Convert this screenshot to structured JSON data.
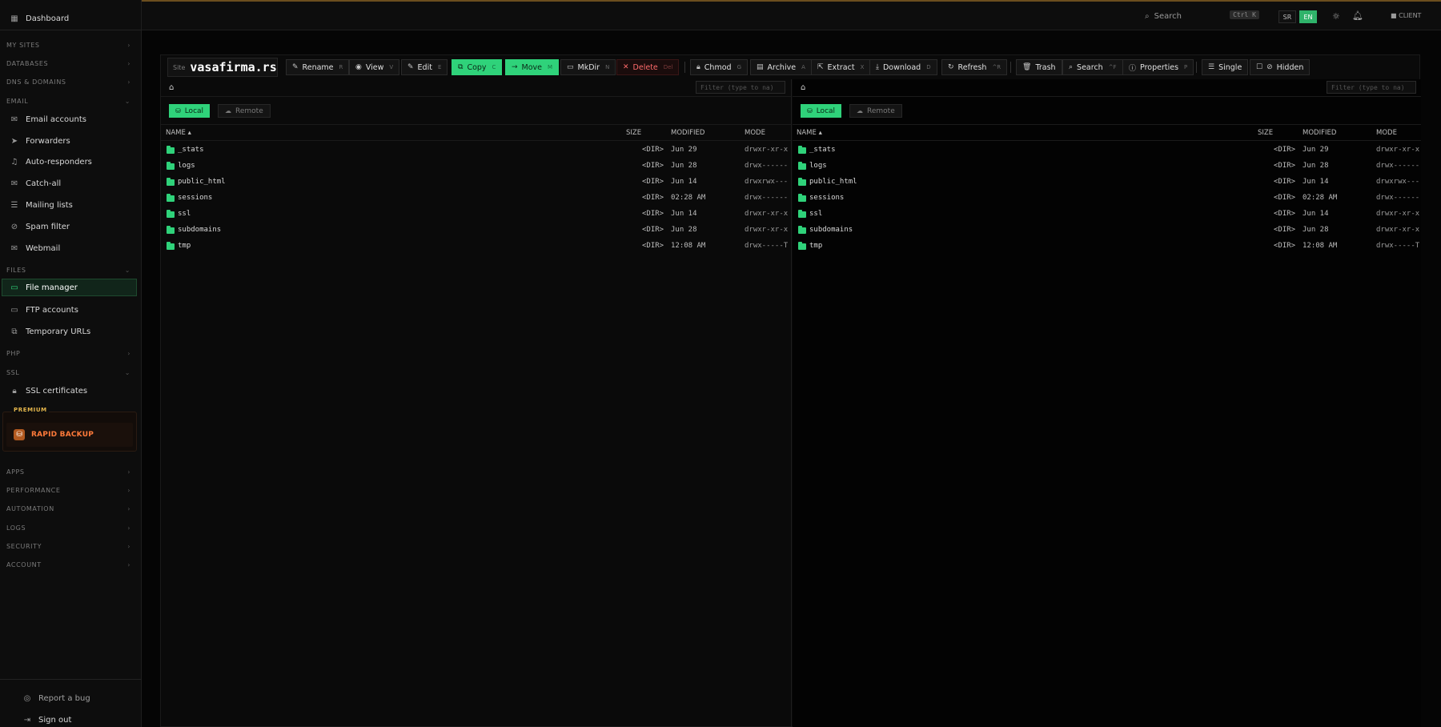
{
  "sidebar": {
    "dashboard": "Dashboard",
    "sections": {
      "my_sites": "MY SITES",
      "databases": "DATABASES",
      "dns": "DNS & DOMAINS",
      "email": "EMAIL",
      "files": "FILES",
      "php": "PHP",
      "ssl": "SSL",
      "apps": "APPS",
      "performance": "PERFORMANCE",
      "automation": "AUTOMATION",
      "logs": "LOGS",
      "security": "SECURITY",
      "account": "ACCOUNT"
    },
    "email_items": [
      "Email accounts",
      "Forwarders",
      "Auto-responders",
      "Catch-all",
      "Mailing lists",
      "Spam filter",
      "Webmail"
    ],
    "files_items": [
      "File manager",
      "FTP accounts",
      "Temporary URLs"
    ],
    "ssl_items": [
      "SSL certificates"
    ],
    "premium_label": "PREMIUM",
    "rapid_backup": "RAPID BACKUP",
    "report_bug": "Report a bug",
    "sign_out": "Sign out"
  },
  "topbar": {
    "search_label": "Search",
    "search_shortcut": "Ctrl K",
    "lang_sr": "SR",
    "lang_en": "EN",
    "client": "CLIENT"
  },
  "toolbar": {
    "site_label": "Site",
    "site_name": "vasafirma.rs",
    "buttons": [
      {
        "label": "Rename",
        "key": "R"
      },
      {
        "label": "View",
        "key": "V"
      },
      {
        "label": "Edit",
        "key": "E"
      },
      {
        "label": "Copy",
        "key": "C"
      },
      {
        "label": "Move",
        "key": "M"
      },
      {
        "label": "MkDir",
        "key": "N"
      },
      {
        "label": "Delete",
        "key": "Del"
      },
      {
        "label": "Chmod",
        "key": "G"
      },
      {
        "label": "Archive",
        "key": "A"
      },
      {
        "label": "Extract",
        "key": "X"
      },
      {
        "label": "Download",
        "key": "D"
      },
      {
        "label": "Refresh",
        "key": "^R"
      },
      {
        "label": "Trash",
        "key": ""
      },
      {
        "label": "Search",
        "key": "^F"
      },
      {
        "label": "Properties",
        "key": "P"
      },
      {
        "label": "Single",
        "key": ""
      },
      {
        "label": "Hidden",
        "key": ""
      }
    ]
  },
  "pane": {
    "filter_placeholder": "Filter (type to na)",
    "local": "Local",
    "remote": "Remote",
    "columns": {
      "name": "NAME ▴",
      "size": "SIZE",
      "modified": "MODIFIED",
      "mode": "MODE"
    },
    "files": [
      {
        "name": "_stats",
        "size": "<DIR>",
        "modified": "Jun 29",
        "mode": "drwxr-xr-x"
      },
      {
        "name": "logs",
        "size": "<DIR>",
        "modified": "Jun 28",
        "mode": "drwx------"
      },
      {
        "name": "public_html",
        "size": "<DIR>",
        "modified": "Jun 14",
        "mode": "drwxrwx---"
      },
      {
        "name": "sessions",
        "size": "<DIR>",
        "modified": "02:28 AM",
        "mode": "drwx------"
      },
      {
        "name": "ssl",
        "size": "<DIR>",
        "modified": "Jun 14",
        "mode": "drwxr-xr-x"
      },
      {
        "name": "subdomains",
        "size": "<DIR>",
        "modified": "Jun 28",
        "mode": "drwxr-xr-x"
      },
      {
        "name": "tmp",
        "size": "<DIR>",
        "modified": "12:08 AM",
        "mode": "drwx-----T"
      }
    ]
  }
}
